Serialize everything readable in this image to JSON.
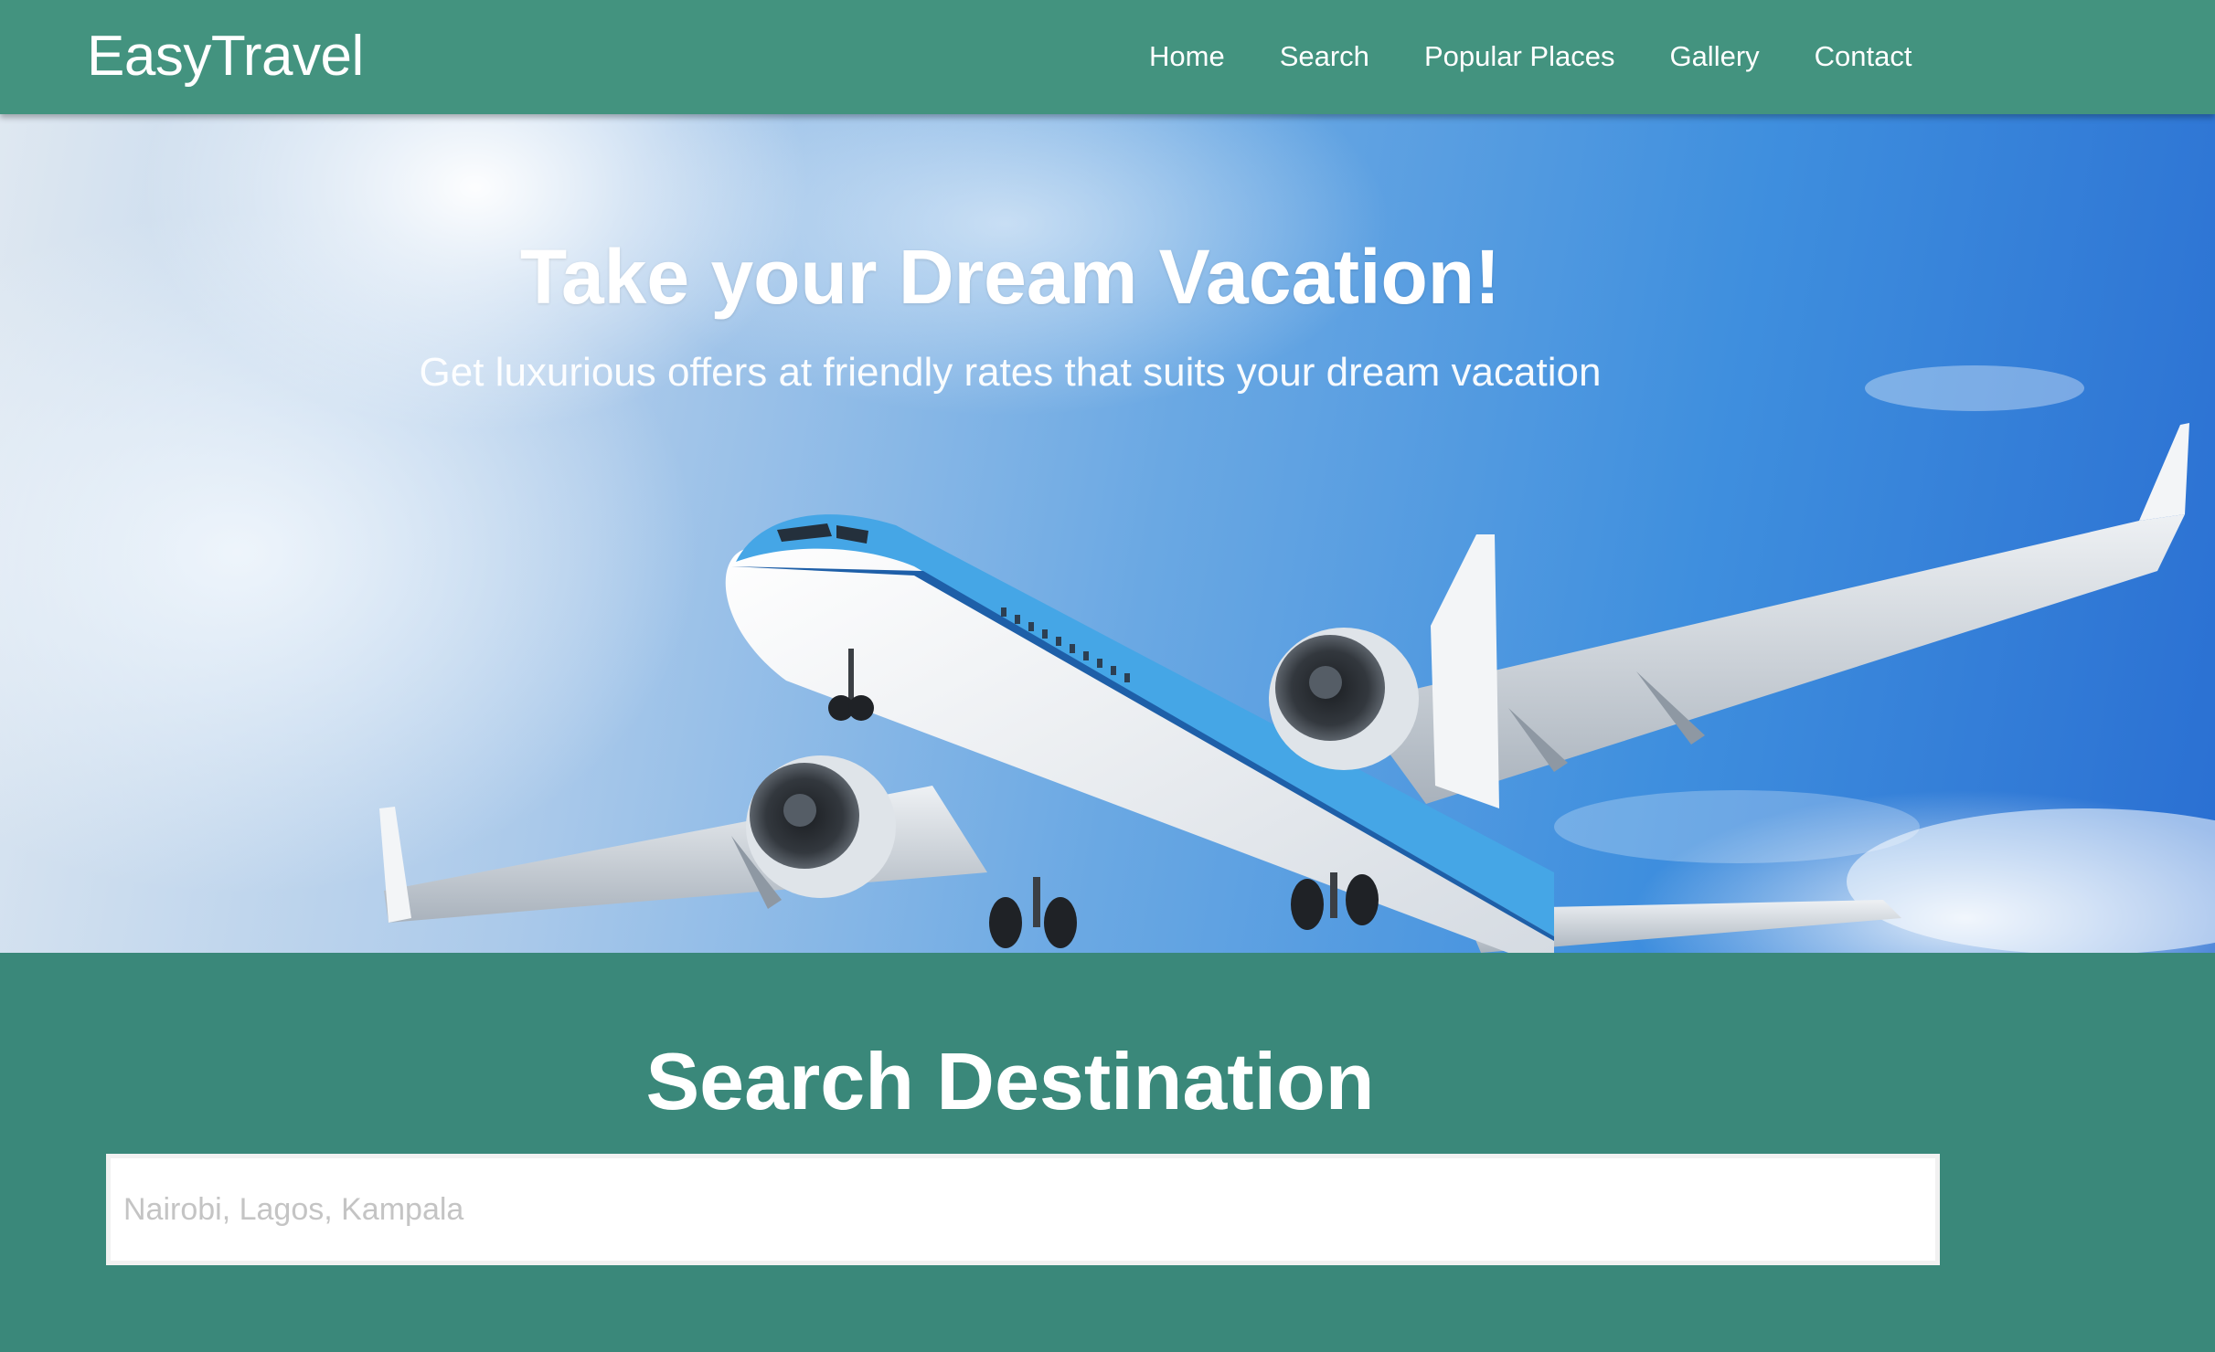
{
  "navbar": {
    "brand": "EasyTravel",
    "links": [
      "Home",
      "Search",
      "Popular Places",
      "Gallery",
      "Contact"
    ]
  },
  "hero": {
    "title": "Take your Dream Vacation!",
    "subtitle": "Get luxurious offers at friendly rates that suits your dream vacation"
  },
  "search": {
    "title": "Search Destination",
    "placeholder": "Nairobi, Lagos, Kampala",
    "value": ""
  },
  "colors": {
    "navbar": "#43937f",
    "section": "#3a887a",
    "text": "#ffffff"
  }
}
